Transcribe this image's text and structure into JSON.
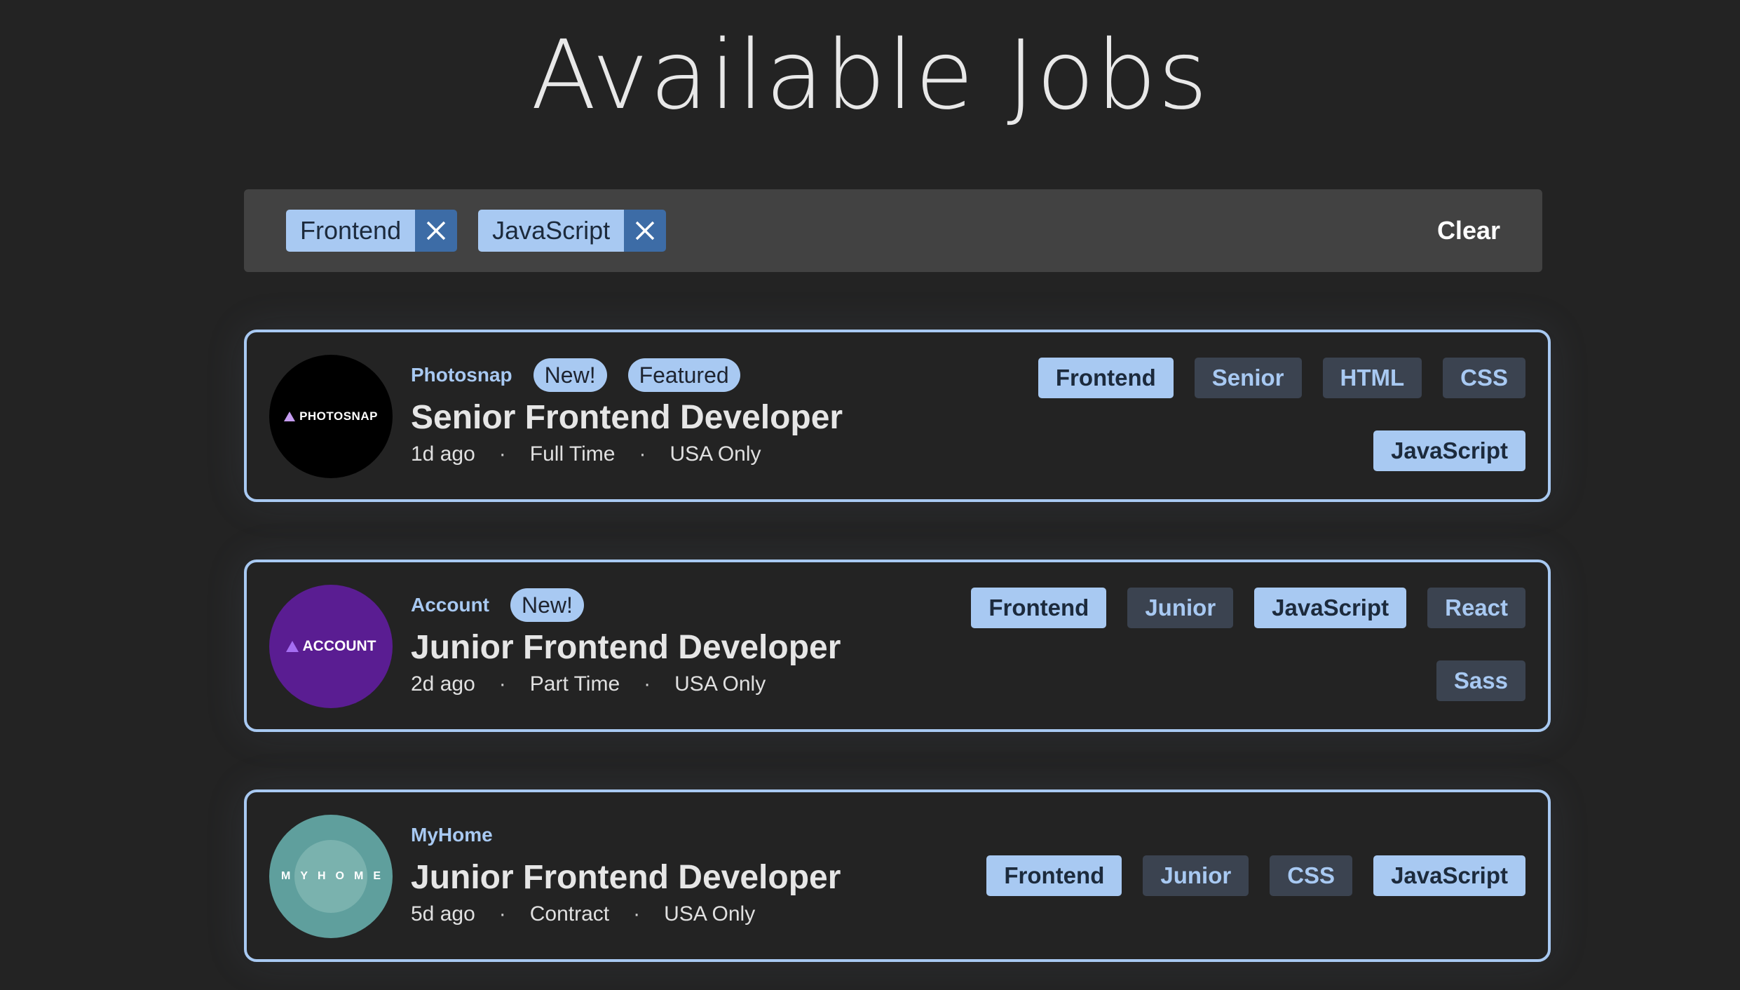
{
  "page": {
    "title": "Available Jobs"
  },
  "filter_bar": {
    "chips": [
      "Frontend",
      "JavaScript"
    ],
    "clear_label": "Clear"
  },
  "jobs": [
    {
      "logo_text": "PHOTOSNAP",
      "company": "Photosnap",
      "badges": [
        "New!",
        "Featured"
      ],
      "title": "Senior Frontend Developer",
      "posted": "1d ago",
      "contract": "Full Time",
      "location": "USA Only",
      "meta_separator": "·",
      "tag_rows": [
        [
          {
            "label": "Frontend",
            "active": true
          },
          {
            "label": "Senior",
            "active": false
          },
          {
            "label": "HTML",
            "active": false
          },
          {
            "label": "CSS",
            "active": false
          }
        ],
        [
          {
            "label": "JavaScript",
            "active": true
          }
        ]
      ]
    },
    {
      "logo_text": "ACCOUNT",
      "company": "Account",
      "badges": [
        "New!"
      ],
      "title": "Junior Frontend Developer",
      "posted": "2d ago",
      "contract": "Part Time",
      "location": "USA Only",
      "meta_separator": "·",
      "tag_rows": [
        [
          {
            "label": "Frontend",
            "active": true
          },
          {
            "label": "Junior",
            "active": false
          },
          {
            "label": "JavaScript",
            "active": true
          },
          {
            "label": "React",
            "active": false
          }
        ],
        [
          {
            "label": "Sass",
            "active": false
          }
        ]
      ]
    },
    {
      "logo_text": "MYHOME",
      "company": "MyHome",
      "badges": [],
      "title": "Junior Frontend Developer",
      "posted": "5d ago",
      "contract": "Contract",
      "location": "USA Only",
      "meta_separator": "·",
      "tag_rows": [
        [
          {
            "label": "Frontend",
            "active": true
          },
          {
            "label": "Junior",
            "active": false
          },
          {
            "label": "CSS",
            "active": false
          },
          {
            "label": "JavaScript",
            "active": true
          }
        ]
      ]
    }
  ],
  "colors": {
    "background": "#232323",
    "accent": "#a8c9f2",
    "accent_dark": "#3d6ca6",
    "tag_inactive_bg": "#3b4350"
  }
}
